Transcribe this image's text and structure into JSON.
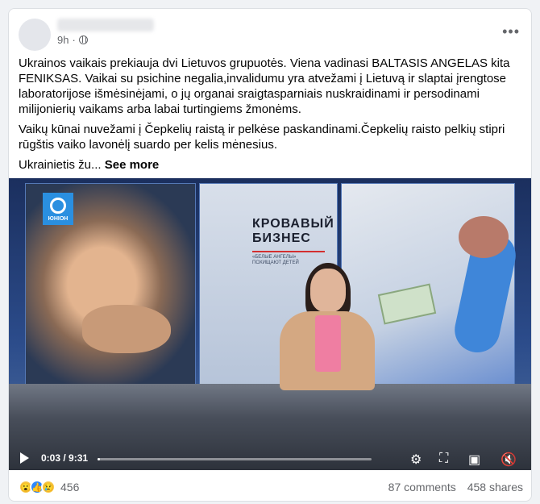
{
  "post": {
    "time": "9h",
    "separator": "·",
    "paragraphs": [
      "Ukrainos vaikais prekiauja dvi Lietuvos grupuotės. Viena vadinasi BALTASIS ANGELAS kita FENIKSAS. Vaikai su psichine negalia,invalidumu yra atvežami į Lietuvą ir slaptai įrengtose laboratorijose išmėsinėjami, o jų organai sraigtasparniais nuskraidinami ir persodinami milijonierių vaikams arba labai turtingiems žmonėms.",
      "Vaikų kūnai nuvežami į Čepkelių raistą ir pelkėse paskandinami.Čepkelių raisto pelkių stipri rūgštis vaiko lavonėlį suardo per kelis mėnesius."
    ],
    "truncated_start": "Ukrainietis žu...",
    "see_more": "See more",
    "more_icon": "ellipsis-icon"
  },
  "video": {
    "channel_logo_text": "ЮНІОН",
    "headline_line1": "КРОВАВЫЙ",
    "headline_line2": "БИЗНЕС",
    "subtitle_line1": "«БЕЛЫЕ АНГЕЛЫ»",
    "subtitle_line2": "ПОХИЩАЮТ ДЕТЕЙ",
    "current_time": "0:03",
    "duration": "9:31",
    "time_display": "0:03 / 9:31",
    "progress_fraction": 0.005,
    "icons": [
      "play-icon",
      "settings-icon",
      "fullscreen-icon",
      "pip-icon",
      "mute-icon"
    ]
  },
  "footer": {
    "reaction_count": "456",
    "comments": "87 comments",
    "shares": "458 shares",
    "reactions": [
      "wow-icon",
      "like-icon",
      "sad-icon"
    ]
  },
  "colors": {
    "link_blue": "#2d88ff",
    "text_secondary": "#65676b",
    "card_bg": "#ffffff"
  }
}
